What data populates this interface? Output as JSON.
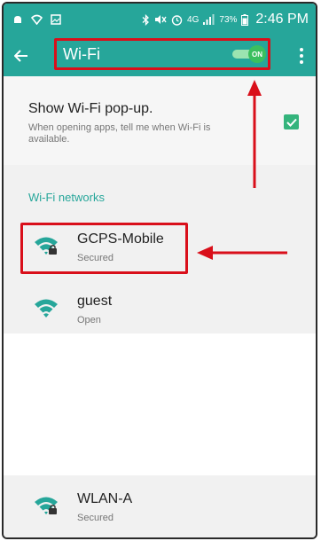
{
  "status_bar": {
    "battery_percent": "73%",
    "time": "2:46 PM",
    "network_type": "4G"
  },
  "action_bar": {
    "back_icon": "arrow-left-icon",
    "title": "Wi-Fi",
    "toggle_label": "ON",
    "toggle_state": "on",
    "overflow_icon": "more-vert-icon"
  },
  "popup_setting": {
    "title": "Show Wi-Fi pop-up.",
    "description": "When opening apps, tell me when Wi-Fi is available.",
    "checked": true
  },
  "networks_section": {
    "label": "Wi-Fi networks"
  },
  "networks": [
    {
      "name": "GCPS-Mobile",
      "status": "Secured",
      "secured": true
    },
    {
      "name": "guest",
      "status": "Open",
      "secured": false
    },
    {
      "name": "WLAN-A",
      "status": "Secured",
      "secured": true
    }
  ],
  "colors": {
    "accent": "#26a69a",
    "annotation_red": "#d90f1a",
    "toggle_on": "#3bbf5e",
    "checkbox": "#34b47c"
  }
}
